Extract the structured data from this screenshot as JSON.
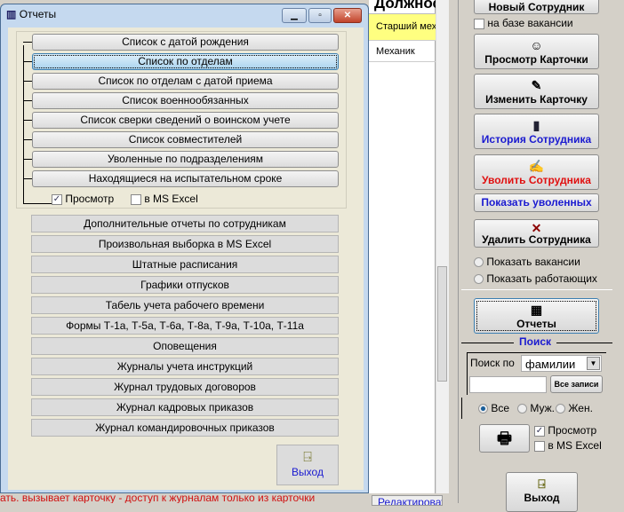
{
  "grid": {
    "header": "Должность",
    "rows": [
      "Старший механик",
      "Механик"
    ]
  },
  "panel": {
    "new_employee": "Новый Сотрудник",
    "on_vacancy": "на базе вакансии",
    "view_card": "Просмотр Карточки",
    "edit_card": "Изменить Карточку",
    "history": "История Сотрудника",
    "dismiss": "Уволить Сотрудника",
    "show_dismissed": "Показать уволенных",
    "delete": "Удалить Сотрудника",
    "show_vacancies": "Показать вакансии",
    "show_working": "Показать работающих",
    "reports": "Отчеты",
    "search_title": "Поиск",
    "search_by": "Поиск по",
    "search_field": "фамилии",
    "all_records": "Все записи",
    "gender": [
      "Все",
      "Муж.",
      "Жен."
    ],
    "preview": "Просмотр",
    "excel": "в MS Excel",
    "exit": "Выход"
  },
  "bottom": {
    "status": "ать. вызывает карточку - доступ к журналам только из карточки",
    "edit": "Редактировать"
  },
  "dialog": {
    "title": "Отчеты",
    "tree_buttons": [
      "Список с датой рождения",
      "Список по отделам",
      "Список по отделам с датой приема",
      "Список военнообязанных",
      "Список сверки сведений о воинском учете",
      "Список совместителей",
      "Уволенные по подразделениям",
      "Находящиеся на испытательном сроке"
    ],
    "preview": "Просмотр",
    "preview_checked": true,
    "excel": "в MS Excel",
    "excel_checked": false,
    "other_buttons": [
      "Дополнительные отчеты по сотрудникам",
      "Произвольная выборка в MS Excel",
      "Штатные расписания",
      "Графики отпусков",
      "Табель учета рабочего времени",
      "Формы Т-1а, Т-5а, Т-6а, Т-8а, Т-9а, Т-10а, Т-11а",
      "Оповещения",
      "Журналы учета инструкций",
      "Журнал трудовых договоров",
      "Журнал кадровых приказов",
      "Журнал командировочных приказов"
    ],
    "exit": "Выход"
  }
}
